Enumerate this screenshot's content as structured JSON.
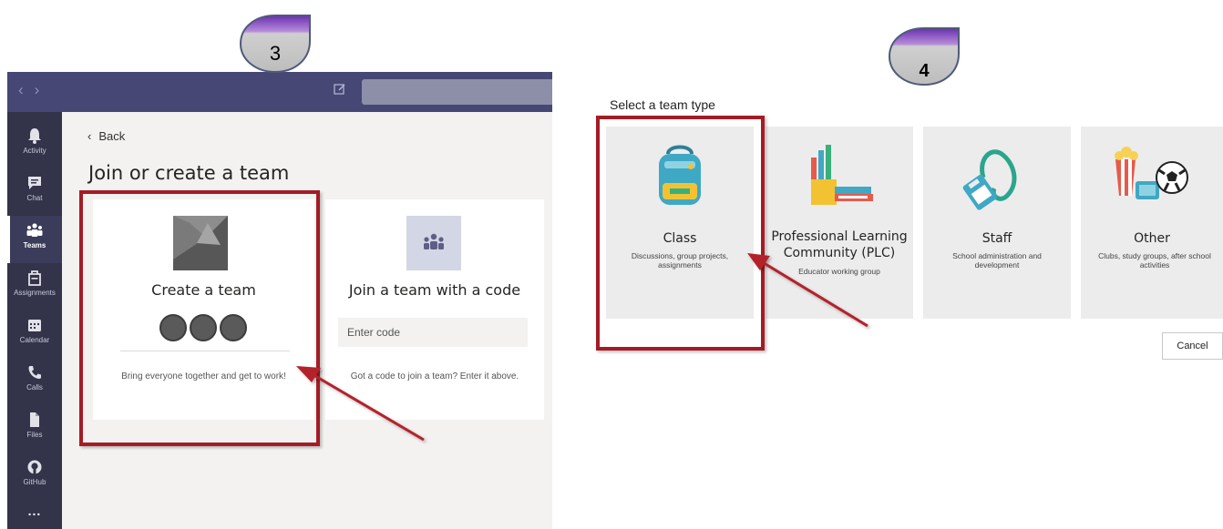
{
  "steps": {
    "left": "3",
    "right": "4"
  },
  "left_window": {
    "rail": [
      {
        "label": "Activity",
        "icon": "bell-icon"
      },
      {
        "label": "Chat",
        "icon": "chat-icon"
      },
      {
        "label": "Teams",
        "icon": "teams-icon",
        "active": true
      },
      {
        "label": "Assignments",
        "icon": "assignments-icon"
      },
      {
        "label": "Calendar",
        "icon": "calendar-icon"
      },
      {
        "label": "Calls",
        "icon": "phone-icon"
      },
      {
        "label": "Files",
        "icon": "file-icon"
      },
      {
        "label": "GitHub",
        "icon": "github-icon"
      },
      {
        "label": "...",
        "icon": "more-icon"
      }
    ],
    "back_label": "Back",
    "page_title": "Join or create a team",
    "create_card": {
      "title": "Create a team",
      "description": "Bring everyone together and get to work!"
    },
    "join_card": {
      "title": "Join a team with a code",
      "input_placeholder": "Enter code",
      "description": "Got a code to join a team? Enter it above."
    }
  },
  "right_panel": {
    "title": "Select a team type",
    "team_types": [
      {
        "name": "Class",
        "description": "Discussions, group projects, assignments",
        "icon": "backpack-icon"
      },
      {
        "name": "Professional Learning Community (PLC)",
        "description": "Educator working group",
        "icon": "books-icon"
      },
      {
        "name": "Staff",
        "description": "School administration and development",
        "icon": "lanyard-icon"
      },
      {
        "name": "Other",
        "description": "Clubs, study groups, after school activities",
        "icon": "popcorn-ball-icon"
      }
    ],
    "cancel_label": "Cancel"
  },
  "colors": {
    "titlebar": "#464775",
    "rail": "#33344a",
    "highlight": "#a31c25",
    "badge_top": "#7b3fb3",
    "badge_body": "#c9c9c9"
  }
}
